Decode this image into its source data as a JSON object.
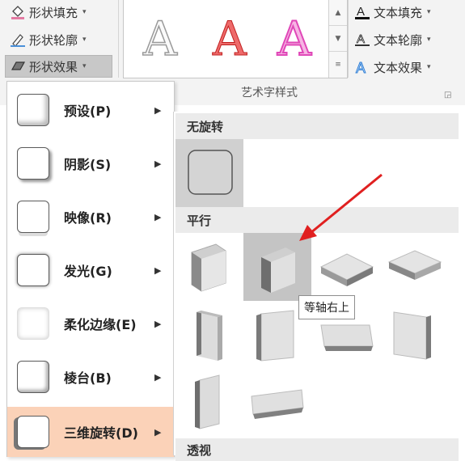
{
  "ribbon": {
    "left_buttons": [
      {
        "label": "形状填充",
        "icon": "paint-bucket-icon"
      },
      {
        "label": "形状轮廓",
        "icon": "pencil-outline-icon"
      },
      {
        "label": "形状效果",
        "icon": "shape-effect-icon"
      }
    ],
    "right_buttons": [
      {
        "label": "文本填充",
        "icon": "text-fill-icon"
      },
      {
        "label": "文本轮廓",
        "icon": "text-outline-icon"
      },
      {
        "label": "文本效果",
        "icon": "text-effect-icon"
      }
    ],
    "wordart_samples": [
      {
        "letter": "A",
        "color": "#c0c0c0"
      },
      {
        "letter": "A",
        "color": "#e8464a"
      },
      {
        "letter": "A",
        "color": "#f06ec8"
      }
    ],
    "group_label": "艺术字样式"
  },
  "menu": {
    "items": [
      {
        "label": "预设(P)"
      },
      {
        "label": "阴影(S)"
      },
      {
        "label": "映像(R)"
      },
      {
        "label": "发光(G)"
      },
      {
        "label": "柔化边缘(E)"
      },
      {
        "label": "棱台(B)"
      },
      {
        "label": "三维旋转(D)",
        "selected": true
      }
    ]
  },
  "submenu": {
    "sections": [
      {
        "title": "无旋转"
      },
      {
        "title": "平行"
      },
      {
        "title": "透视"
      }
    ],
    "tooltip": "等轴右上"
  },
  "colors": {
    "accent_selected": "#fbd2b8",
    "arrow": "#e02020"
  }
}
